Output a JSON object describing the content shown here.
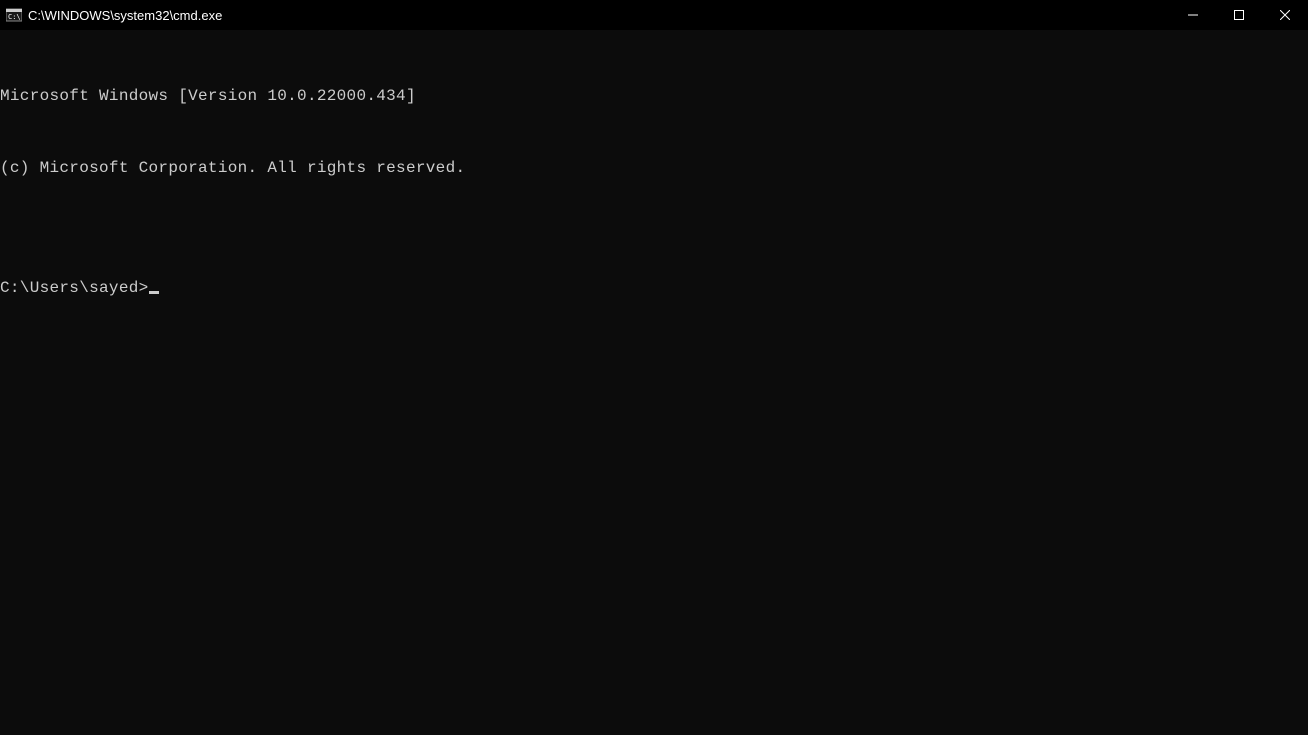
{
  "titlebar": {
    "title": "C:\\WINDOWS\\system32\\cmd.exe"
  },
  "terminal": {
    "line1": "Microsoft Windows [Version 10.0.22000.434]",
    "line2": "(c) Microsoft Corporation. All rights reserved.",
    "blank": "",
    "prompt": "C:\\Users\\sayed>"
  }
}
